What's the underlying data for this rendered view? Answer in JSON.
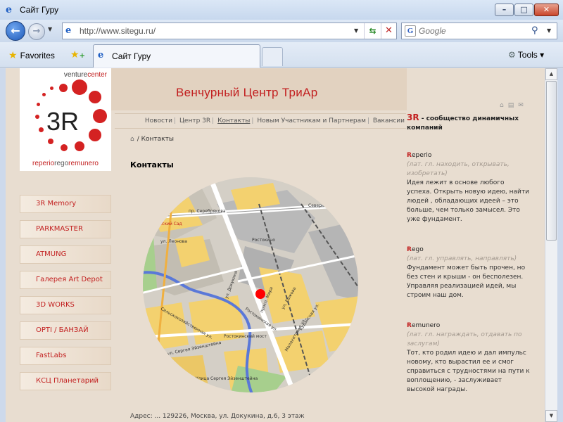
{
  "window": {
    "title": "Сайт Гуру"
  },
  "navigation": {
    "url": "http://www.sitegu.ru/",
    "search_placeholder": "Google"
  },
  "tabs": {
    "favorites_label": "Favorites",
    "active_tab_label": "Сайт Гуру",
    "tools_label": "Tools"
  },
  "site": {
    "logo_top_venture": "venture",
    "logo_top_center": "center",
    "logo_mark": "3R",
    "logo_bottom_1": "reperio",
    "logo_bottom_2": "rego",
    "logo_bottom_3": "remunero",
    "title": "Венчурный Центр ТриАр"
  },
  "menu": [
    "3R Memory",
    "PARKMASTER",
    "ATMUNG",
    "Галерея Art Depot",
    "3D WORKS",
    "OPTI / БАНЗАЙ",
    "FastLabs",
    "КСЦ Планетарий"
  ],
  "topnav": [
    "Новости",
    "Центр 3R",
    "Контакты",
    "Новым Участникам и Партнерам",
    "Вакансии"
  ],
  "breadcrumb": {
    "current": "Контакты"
  },
  "page": {
    "heading": "Контакты",
    "caption": "Адрес: ... 129226, Москва, ул. Докукина, д.6, 3 этаж"
  },
  "map_labels": {
    "garden": "Ботанический Сад",
    "street_1": "пр. Серебрякова",
    "street_2": "Северный",
    "street_3": "Ростокино",
    "street_4": "Ростокинский мост",
    "street_5": "Улица Сергея Эйзенштейна",
    "street_6": "ул. Сергея Эйзенштейна",
    "street_7": "Сельскохозяйственная ул.",
    "street_8": "просп. Мира",
    "street_9": "ул. Бажова",
    "street_10": "Малахитовая ул.",
    "street_11": "Ростокинская ул.",
    "street_12": "ул. Докукина",
    "street_13": "Будайская ул.",
    "street_14": "ул. Леонова"
  },
  "right": {
    "tagline_mark": "3R",
    "tagline_rest": " - сообщество динамичных компаний",
    "terms": [
      {
        "letter": "R",
        "rest": "eperio",
        "translation": "(лат. гл. находить, открывать, изобретать)",
        "text": "Идея лежит в основе любого успеха. Открыть новую идею, найти людей , обладающих идеей – это больше, чем только замысел. Это уже фундамент."
      },
      {
        "letter": "R",
        "rest": "ego",
        "translation": "(лат. гл. управлять, направлять)",
        "text": "Фундамент может быть прочен, но без стен и крыши - он бесполезен. Управляя реализацией идей, мы строим наш дом."
      },
      {
        "letter": "R",
        "rest": "emunero",
        "translation": "(лат. гл. награждать, отдавать по заслугам)",
        "text": "Тот, кто родил идею и дал импульс новому, кто вырастил ее и смог справиться с трудностями на пути к воплощению, - заслуживает высокой награды."
      }
    ]
  }
}
